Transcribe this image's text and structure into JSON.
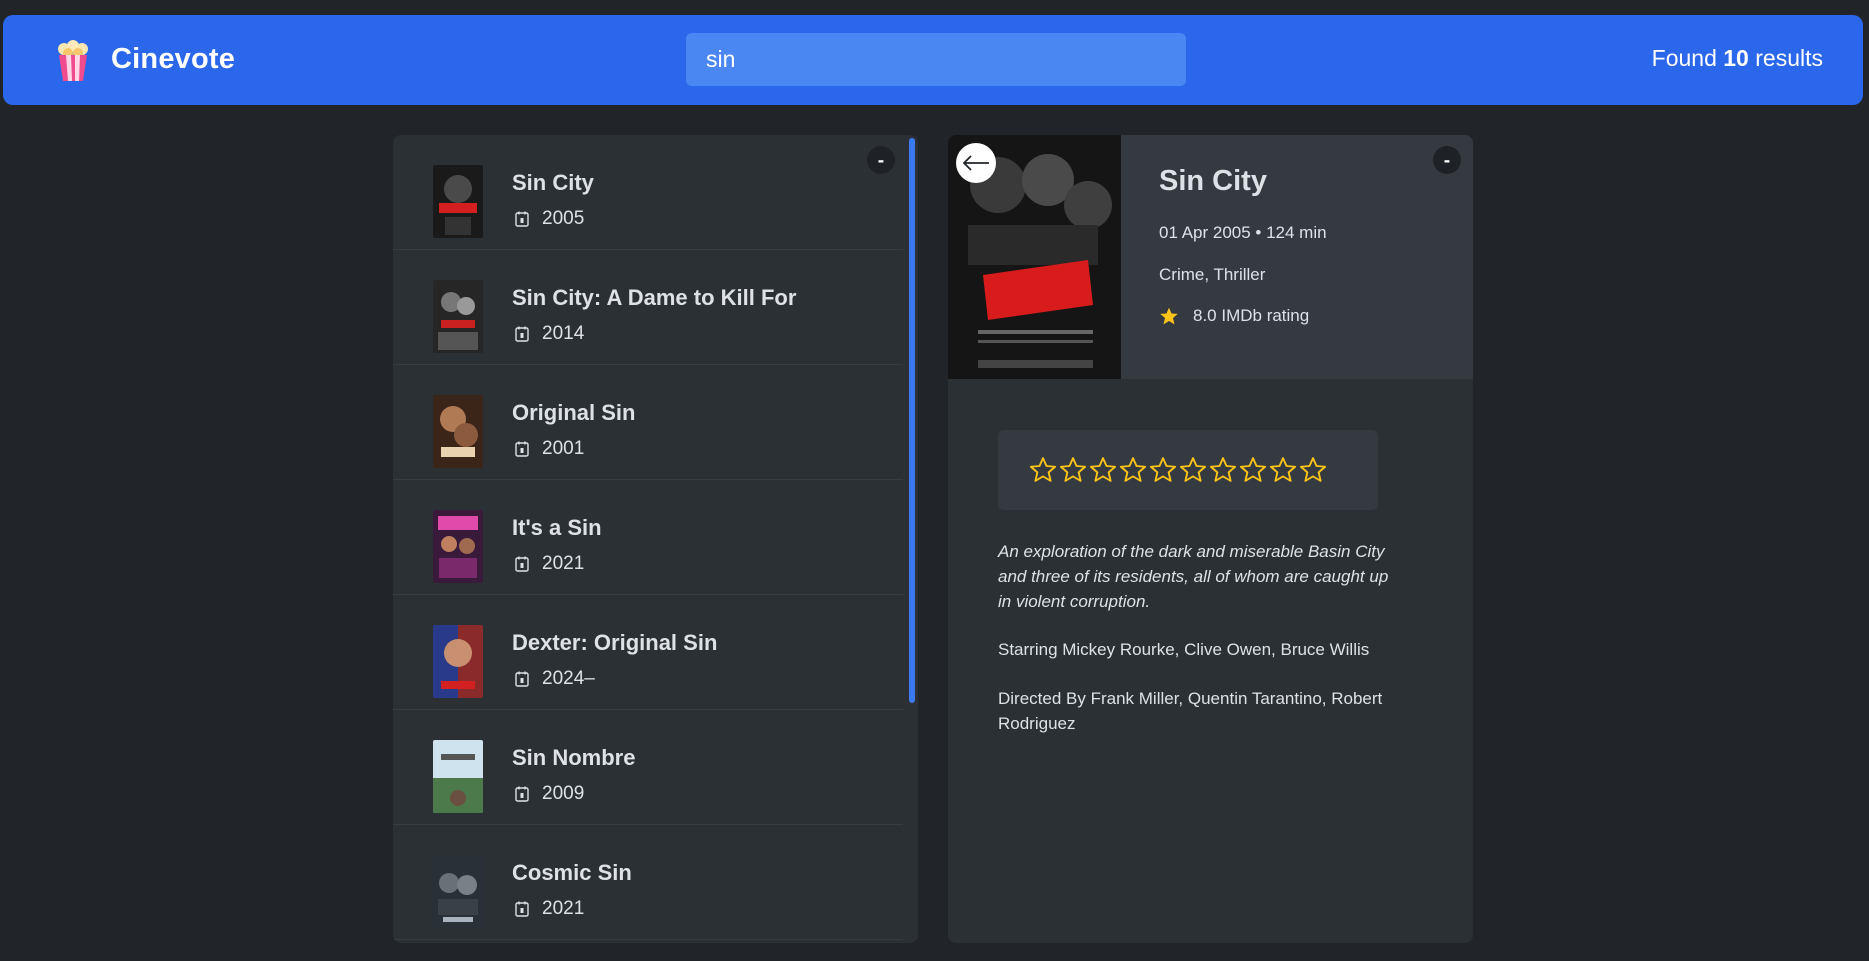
{
  "app": {
    "name": "Cinevote",
    "search_value": "sin",
    "results_prefix": "Found",
    "results_count": "10",
    "results_suffix": "results"
  },
  "list": {
    "minimize_label": "-",
    "movies": [
      {
        "title": "Sin City",
        "year": "2005"
      },
      {
        "title": "Sin City: A Dame to Kill For",
        "year": "2014"
      },
      {
        "title": "Original Sin",
        "year": "2001"
      },
      {
        "title": "It's a Sin",
        "year": "2021"
      },
      {
        "title": "Dexter: Original Sin",
        "year": "2024–"
      },
      {
        "title": "Sin Nombre",
        "year": "2009"
      },
      {
        "title": "Cosmic Sin",
        "year": "2021"
      }
    ]
  },
  "detail": {
    "minimize_label": "-",
    "title": "Sin City",
    "date_runtime": "01 Apr 2005 • 124 min",
    "genres": "Crime, Thriller",
    "rating": "8.0 IMDb rating",
    "user_stars_max": 10,
    "plot": "An exploration of the dark and miserable Basin City and three of its residents, all of whom are caught up in violent corruption.",
    "starring": "Starring Mickey Rourke, Clive Owen, Bruce Willis",
    "directed": "Directed By Frank Miller, Quentin Tarantino, Robert Rodriguez"
  },
  "colors": {
    "background": "#212529",
    "navbar": "#2b67ea",
    "box": "#2b3035",
    "accent": "#3a79f0",
    "star": "#fcc419"
  },
  "icons": {
    "logo": "popcorn-icon",
    "year": "calendar-icon",
    "rating": "star-icon",
    "back": "arrow-left-icon"
  }
}
